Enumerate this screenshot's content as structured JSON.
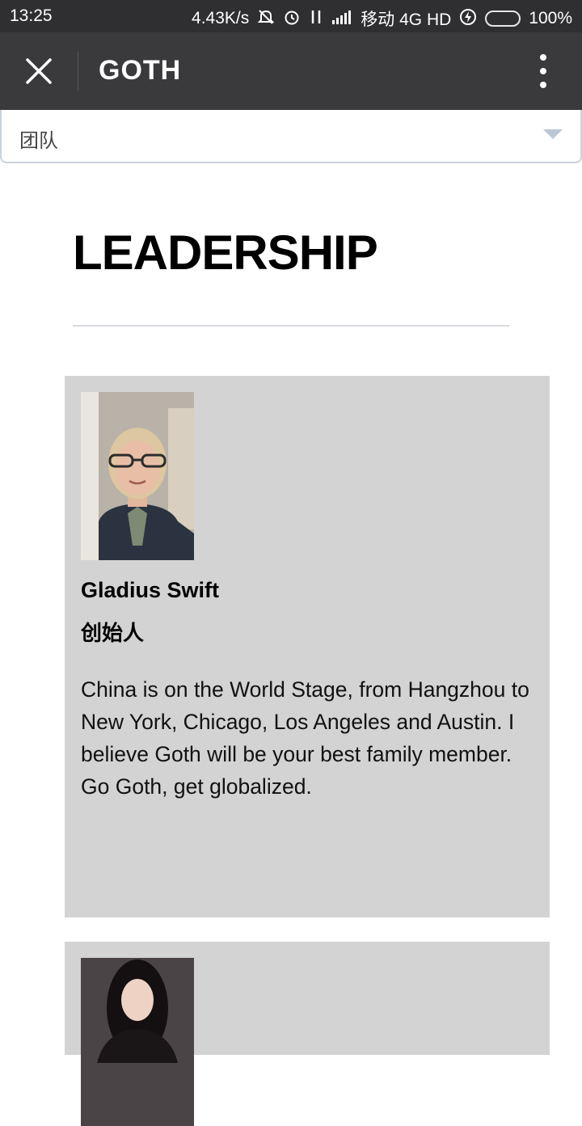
{
  "status_bar": {
    "time": "13:25",
    "network_speed": "4.43K/s",
    "carrier": "移动 4G HD",
    "battery_text": "100%",
    "icons": [
      "mute-icon",
      "alarm-icon",
      "data-arrows-icon",
      "signal-icon",
      "charging-icon",
      "battery-icon"
    ]
  },
  "app_bar": {
    "title": "GOTH",
    "close_icon": "close-icon",
    "menu_icon": "more-vertical-icon"
  },
  "dropdown": {
    "selected": "团队",
    "icon": "chevron-down-icon"
  },
  "page": {
    "heading": "LEADERSHIP"
  },
  "leaders": [
    {
      "name": "Gladius Swift",
      "role": "创始人",
      "bio": "China is on the World Stage, from Hangzhou to New York, Chicago, Los Angeles and Austin. I believe Goth will be your best family member. Go Goth, get globalized."
    },
    {
      "name": "",
      "role": "",
      "bio": ""
    }
  ],
  "colors": {
    "status_bar_bg": "#2f2f31",
    "app_bar_bg": "#3a3a3c",
    "card_bg": "#d3d3d3",
    "battery_green": "#3bd13b"
  }
}
